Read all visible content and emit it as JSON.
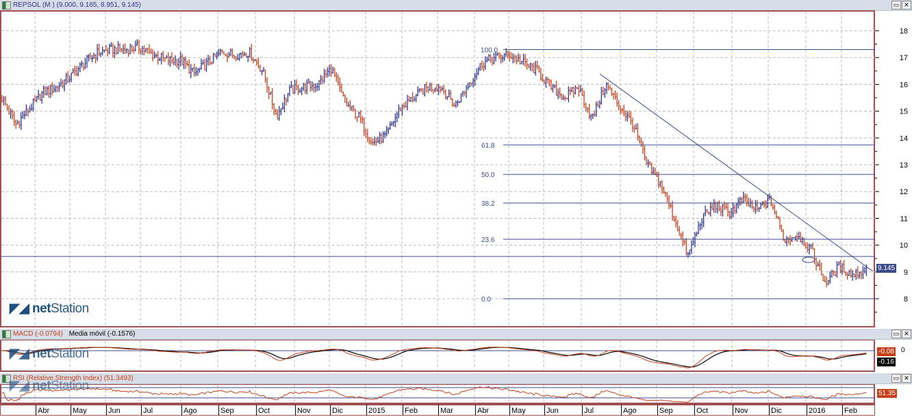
{
  "main_panel": {
    "title": "REPSOL (M ) (9.000, 9.165, 8.951, 9.145)",
    "last_price": "9.145"
  },
  "macd_panel": {
    "title_macd": "MACD (-0.0794)",
    "title_sep": " - ",
    "title_ma": "Media móvil (-0.1576)",
    "macd_value": "-0.08",
    "signal_value": "-0.16",
    "zero_label": "0"
  },
  "rsi_panel": {
    "title": "RSI (Relative Strength Index) (51.3493)",
    "value": "51.35"
  },
  "logo": {
    "text_bold": "net",
    "text": "Station"
  },
  "window_buttons": {
    "maximize": "▭",
    "close": "✕"
  },
  "colors": {
    "up": "#2b3590",
    "down": "#c8401a",
    "frame": "#a05050",
    "line": "#2b3590",
    "macd": "#c8401a",
    "signal": "#000000"
  },
  "chart_data": {
    "type": "ohlc",
    "title": "REPSOL (M )",
    "ylim": [
      7.0,
      18.8
    ],
    "y_ticks": [
      "18",
      "17",
      "16",
      "15",
      "14",
      "13",
      "12",
      "11",
      "10",
      "9",
      "8"
    ],
    "x_ticks": [
      "Abr",
      "May",
      "Jun",
      "Jul",
      "Ago",
      "Sep",
      "Oct",
      "Nov",
      "Dic",
      "2015",
      "Feb",
      "Mar",
      "Abr",
      "May",
      "Jun",
      "Jul",
      "Ago",
      "Sep",
      "Oct",
      "Nov",
      "Dic",
      "2016",
      "Feb"
    ],
    "approx_close_path": [
      15.5,
      14.5,
      15.1,
      15.7,
      15.9,
      16.3,
      16.8,
      17.2,
      17.3,
      17.3,
      17.4,
      17.1,
      16.9,
      16.9,
      16.4,
      16.8,
      17.2,
      17.1,
      17.2,
      16.5,
      14.8,
      15.8,
      15.9,
      16.0,
      16.6,
      15.3,
      14.8,
      13.8,
      14.1,
      15.1,
      15.5,
      15.9,
      15.9,
      15.2,
      16.0,
      16.8,
      17.0,
      17.1,
      16.8,
      16.5,
      15.9,
      15.5,
      15.9,
      14.7,
      16.0,
      15.2,
      14.5,
      13.0,
      12.3,
      11.0,
      9.6,
      11.0,
      11.5,
      11.2,
      11.7,
      11.3,
      11.7,
      10.2,
      10.4,
      9.8,
      8.6,
      9.2,
      8.9,
      9.1
    ],
    "fibonacci": [
      {
        "label": "100.0",
        "value": 17.3
      },
      {
        "label": "61.8",
        "value": 13.74
      },
      {
        "label": "50.0",
        "value": 12.64
      },
      {
        "label": "38.2",
        "value": 11.57
      },
      {
        "label": "23.6",
        "value": 10.22
      },
      {
        "label": "0.0",
        "value": 8.0
      }
    ],
    "support_line": 9.58,
    "trendline": {
      "start": 16.39,
      "end": 9.02
    },
    "last": {
      "open": 9.0,
      "high": 9.165,
      "low": 8.951,
      "close": 9.145
    },
    "macd": {
      "macd": -0.0794,
      "signal": -0.1576
    },
    "rsi": {
      "value": 51.3493,
      "levels": [
        70,
        30
      ]
    }
  }
}
